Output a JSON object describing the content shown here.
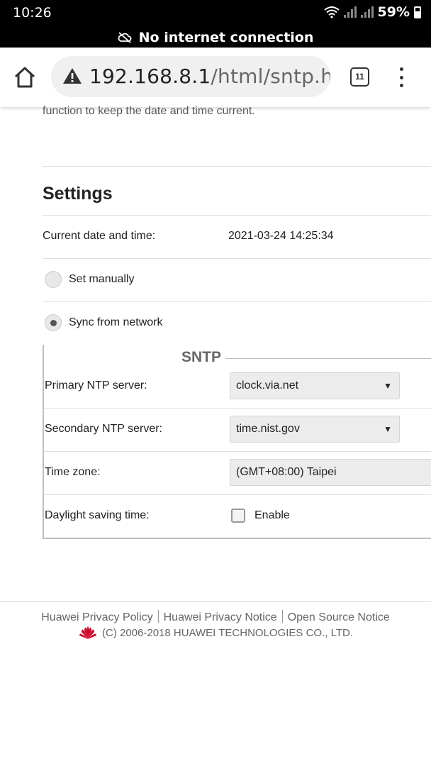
{
  "status_bar": {
    "time": "10:26",
    "battery": "59%"
  },
  "banner": {
    "text": "No internet connection"
  },
  "browser": {
    "url_host": "192.168.8.1",
    "url_path": "/html/sntp.ht",
    "tab_count": "11"
  },
  "page": {
    "intro": "function to keep the date and time current.",
    "settings_title": "Settings",
    "current_label": "Current date and time:",
    "current_value": "2021-03-24 14:25:34",
    "radio_manual": "Set manually",
    "radio_sync": "Sync from network",
    "sntp_legend": "SNTP",
    "primary_label": "Primary NTP server:",
    "primary_value": "clock.via.net",
    "secondary_label": "Secondary NTP server:",
    "secondary_value": "time.nist.gov",
    "timezone_label": "Time zone:",
    "timezone_value": "(GMT+08:00) Taipei",
    "dst_label": "Daylight saving time:",
    "dst_checkbox_label": "Enable"
  },
  "footer": {
    "link_privacy_policy": "Huawei Privacy Policy",
    "link_privacy_notice": "Huawei Privacy Notice",
    "link_open_source": "Open Source Notice",
    "copyright": "(C) 2006-2018 HUAWEI TECHNOLOGIES CO., LTD."
  },
  "icons": {
    "home": "home-icon",
    "warning": "warning-icon",
    "tabs": "tabs-icon",
    "menu": "more-vert-icon",
    "cloud_off": "cloud-off-icon",
    "wifi": "wifi-icon",
    "logo": "huawei-logo"
  },
  "colors": {
    "brand_red": "#cf0a2c"
  }
}
